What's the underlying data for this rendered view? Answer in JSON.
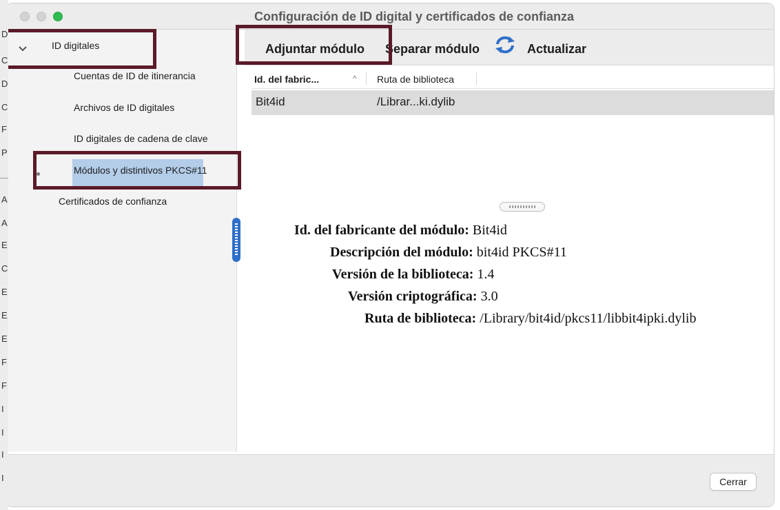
{
  "window": {
    "title": "Configuración de ID digital y certificados de confianza"
  },
  "sidebar": {
    "group_label": "ID digitales",
    "items": [
      {
        "label": "Cuentas de ID de itinerancia"
      },
      {
        "label": "Archivos de ID digitales"
      },
      {
        "label": "ID digitales de cadena de clave"
      },
      {
        "label": "Módulos y distintivos PKCS#11"
      }
    ],
    "trusted_label": "Certificados de confianza"
  },
  "toolbar": {
    "attach_label": "Adjuntar módulo",
    "detach_label": "Separar módulo",
    "refresh_label": "Actualizar"
  },
  "table": {
    "columns": [
      "Id. del fabric...",
      "Ruta de biblioteca"
    ],
    "rows": [
      {
        "manufacturer": "Bit4id",
        "path": "/Librar...ki.dylib"
      }
    ]
  },
  "details": {
    "manufacturer_label": "Id. del fabricante del módulo:",
    "manufacturer_value": "Bit4id",
    "description_label": "Descripción del módulo:",
    "description_value": "bit4id PKCS#11",
    "library_version_label": "Versión de la biblioteca:",
    "library_version_value": "1.4",
    "crypto_version_label": "Versión criptográfica:",
    "crypto_version_value": "3.0",
    "library_path_label": "Ruta de biblioteca:",
    "library_path_value": "/Library/bit4id/pkcs11/libbit4ipki.dylib"
  },
  "footer": {
    "close_label": "Cerrar"
  },
  "background_window": {
    "edge_letters": [
      "D",
      "C",
      "D",
      "C",
      "F",
      "P",
      "A",
      "A",
      "E",
      "C",
      "E",
      "E",
      "E",
      "F",
      "F",
      "I",
      "I",
      "I",
      "I"
    ]
  },
  "colors": {
    "highlight_box": "#5a1a28",
    "selection": "#b3cde8",
    "accent_blue": "#2f6fc9",
    "traffic_green": "#2fbb4f"
  }
}
